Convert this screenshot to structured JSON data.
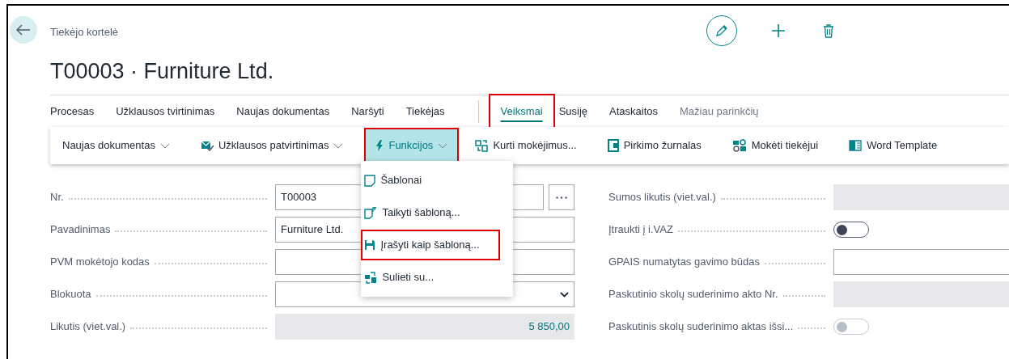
{
  "page": {
    "caption": "Tiekėjo kortelė",
    "title": "T00003 · Furniture Ltd."
  },
  "tab_groups": [
    {
      "tabs": [
        {
          "label": "Procesas",
          "selected": false,
          "highlighted": false
        },
        {
          "label": "Užklausos tvirtinimas",
          "selected": false,
          "highlighted": false
        },
        {
          "label": "Naujas dokumentas",
          "selected": false,
          "highlighted": false
        },
        {
          "label": "Naršyti",
          "selected": false,
          "highlighted": false
        },
        {
          "label": "Tiekėjas",
          "selected": false,
          "highlighted": false
        }
      ]
    },
    {
      "tabs": [
        {
          "label": "Veiksmai",
          "selected": true,
          "highlighted": true
        },
        {
          "label": "Susiję",
          "selected": false,
          "highlighted": false
        },
        {
          "label": "Ataskaitos",
          "selected": false,
          "highlighted": false
        }
      ]
    }
  ],
  "less_options_link": "Mažiau parinkčių",
  "actions": [
    {
      "label": "Naujas dokumentas",
      "dropdown": true,
      "expanded": false,
      "highlighted": false
    },
    {
      "label": "Užklausos patvirtinimas",
      "dropdown": true,
      "expanded": false,
      "highlighted": false
    },
    {
      "label": "Funkcijos",
      "dropdown": true,
      "expanded": true,
      "highlighted": true
    },
    {
      "label": "Kurti mokėjimus...",
      "dropdown": false,
      "expanded": false,
      "highlighted": false
    },
    {
      "label": "Pirkimo žurnalas",
      "dropdown": false,
      "expanded": false,
      "highlighted": false
    },
    {
      "label": "Mokėti tiekėjui",
      "dropdown": false,
      "expanded": false,
      "highlighted": false
    },
    {
      "label": "Word Template",
      "dropdown": false,
      "expanded": false,
      "highlighted": false
    }
  ],
  "menu": [
    {
      "label": "Šablonai",
      "highlighted": false
    },
    {
      "label": "Taikyti šabloną...",
      "highlighted": false
    },
    {
      "label": "Įrašyti kaip šabloną...",
      "highlighted": true
    },
    {
      "label": "Sulieti su...",
      "highlighted": false
    }
  ],
  "fields_left": [
    {
      "label": "Nr.",
      "kind": "lookup",
      "value": "T00003"
    },
    {
      "label": "Pavadinimas",
      "kind": "text",
      "value": "Furniture Ltd."
    },
    {
      "label": "PVM mokėtojo kodas",
      "kind": "text"
    },
    {
      "label": "Blokuota",
      "kind": "select"
    },
    {
      "label": "Likutis (viet.val.)",
      "kind": "readonly",
      "value": "5 850,00"
    }
  ],
  "fields_right": [
    {
      "label": "Sumos likutis (viet.val.)",
      "kind": "readonly"
    },
    {
      "label": "Įtraukti į i.VAZ",
      "kind": "toggle",
      "on": false,
      "disabled": false
    },
    {
      "label": "GPAIS numatytas gavimo būdas",
      "kind": "text"
    },
    {
      "label": "Paskutinio skolų suderinimo akto Nr.",
      "kind": "readonly"
    },
    {
      "label": "Paskutinis skolų suderinimo aktas išsi...",
      "kind": "toggle",
      "on": false,
      "disabled": true
    }
  ]
}
